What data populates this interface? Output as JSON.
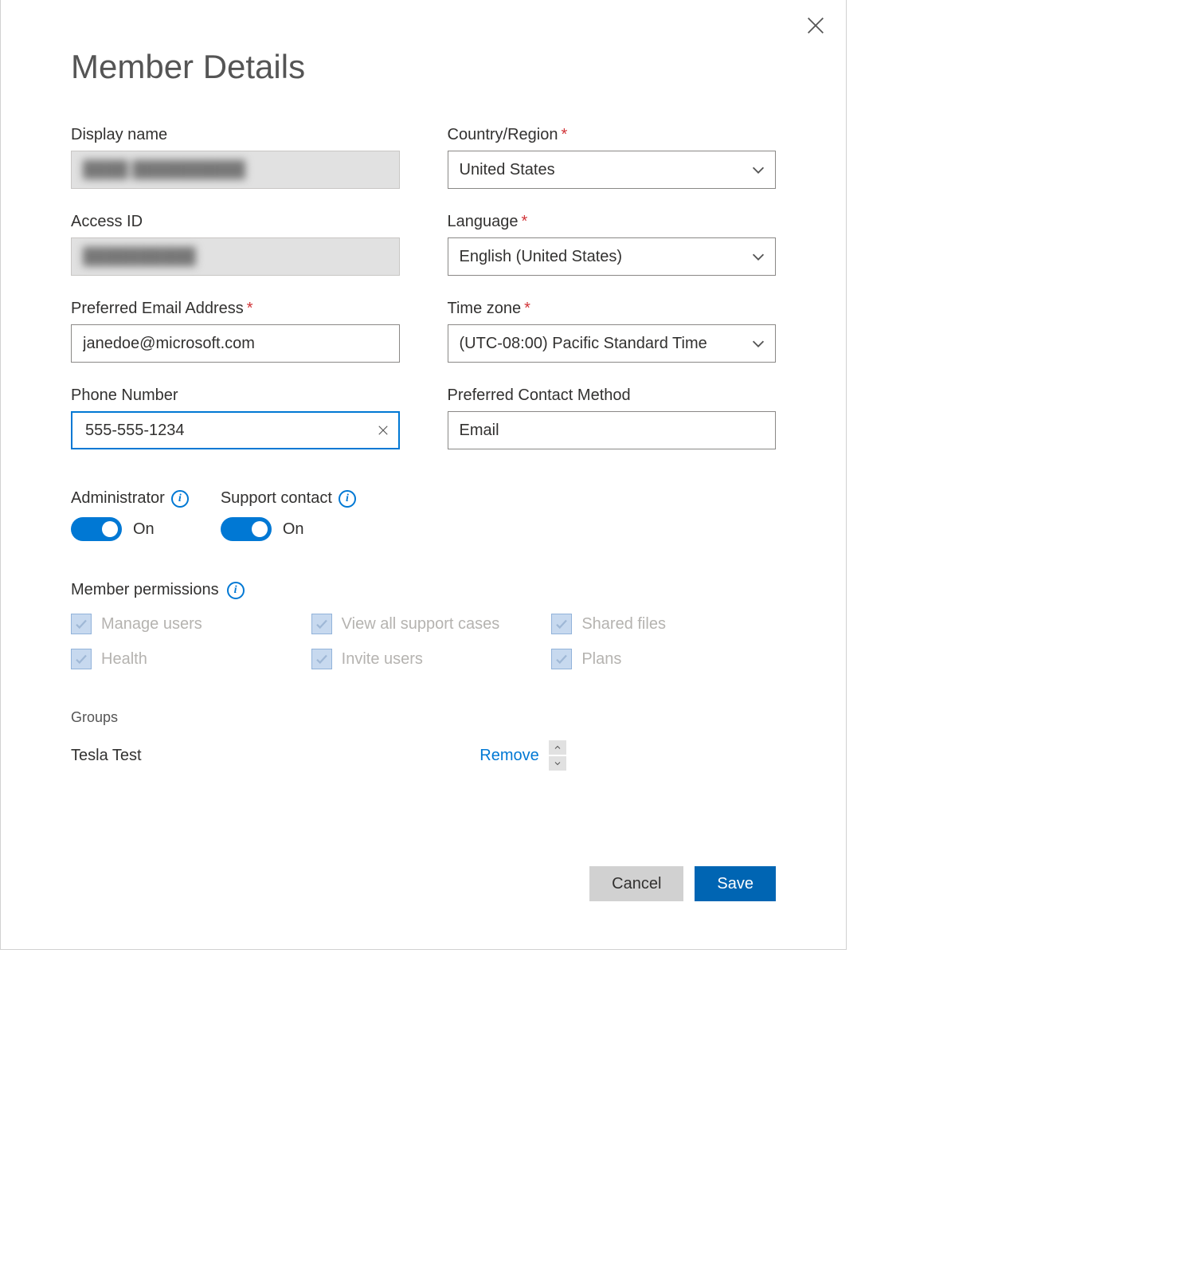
{
  "title": "Member Details",
  "fields": {
    "display_name": {
      "label": "Display name",
      "value": "████ ██████████"
    },
    "access_id": {
      "label": "Access ID",
      "value": "██████████"
    },
    "email": {
      "label": "Preferred Email Address",
      "value": "janedoe@microsoft.com"
    },
    "phone": {
      "label": "Phone Number",
      "value": "555-555-1234"
    },
    "country": {
      "label": "Country/Region",
      "value": "United States"
    },
    "language": {
      "label": "Language",
      "value": "English (United States)"
    },
    "timezone": {
      "label": "Time zone",
      "value": "(UTC-08:00) Pacific Standard Time"
    },
    "contact_method": {
      "label": "Preferred Contact Method",
      "value": "Email"
    }
  },
  "toggles": {
    "administrator": {
      "label": "Administrator",
      "state_text": "On"
    },
    "support_contact": {
      "label": "Support contact",
      "state_text": "On"
    }
  },
  "permissions": {
    "title": "Member permissions",
    "items": [
      "Manage users",
      "View all support cases",
      "Shared files",
      "Health",
      "Invite users",
      "Plans"
    ]
  },
  "groups": {
    "title": "Groups",
    "rows": [
      {
        "name": "Tesla Test",
        "action": "Remove"
      }
    ]
  },
  "footer": {
    "cancel": "Cancel",
    "save": "Save"
  }
}
